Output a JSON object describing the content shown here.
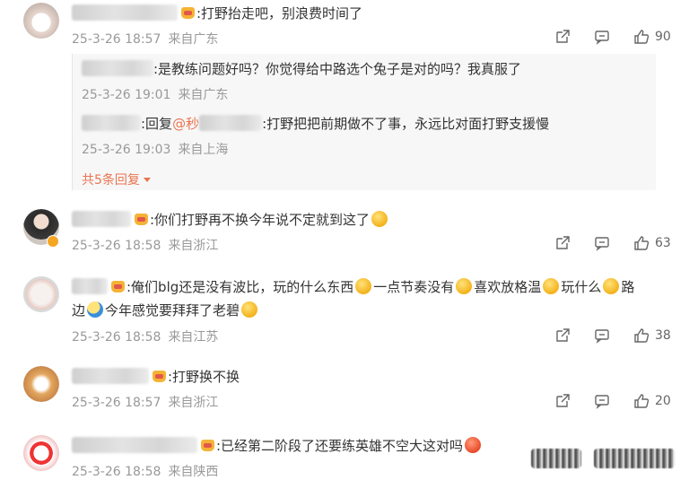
{
  "colors": {
    "accent": "#eb7350",
    "meta": "#999999",
    "text": "#333333"
  },
  "comments": [
    {
      "text": ":打野抬走吧，别浪费时间了",
      "date": "25-3-26 18:57",
      "location": "来自广东",
      "likes": "90",
      "sub": {
        "replies": [
          {
            "text": ":是教练问题好吗？你觉得给中路选个兔子是对的吗？我真服了",
            "date": "25-3-26 19:01",
            "location": "来自广东"
          },
          {
            "prefix": ":回复",
            "at": "@秒",
            "text": ":打野把把前期做不了事，永远比对面打野支援慢",
            "date": "25-3-26 19:03",
            "location": "来自上海"
          }
        ],
        "more": "共5条回复"
      }
    },
    {
      "text": ":你们打野再不换今年说不定就到这了",
      "date": "25-3-26 18:58",
      "location": "来自浙江",
      "likes": "63"
    },
    {
      "text_parts": [
        ":俺们blg还是没有波比，玩的什么东西",
        "一点节奏没有",
        "喜欢放格温",
        "玩什么",
        "路"
      ],
      "text2_parts": [
        "边",
        "今年感觉要拜拜了老碧"
      ],
      "date": "25-3-26 18:58",
      "location": "来自江苏",
      "likes": "38"
    },
    {
      "text": ":打野换不换",
      "date": "25-3-26 18:57",
      "location": "来自浙江",
      "likes": "20"
    },
    {
      "text": ":已经第二阶段了还要练英雄不空大这对吗",
      "date": "25-3-26 18:58",
      "location": "来自陕西"
    }
  ],
  "icons": {
    "share": "share-icon",
    "comment": "comment-icon",
    "like": "thumb-up-icon"
  }
}
